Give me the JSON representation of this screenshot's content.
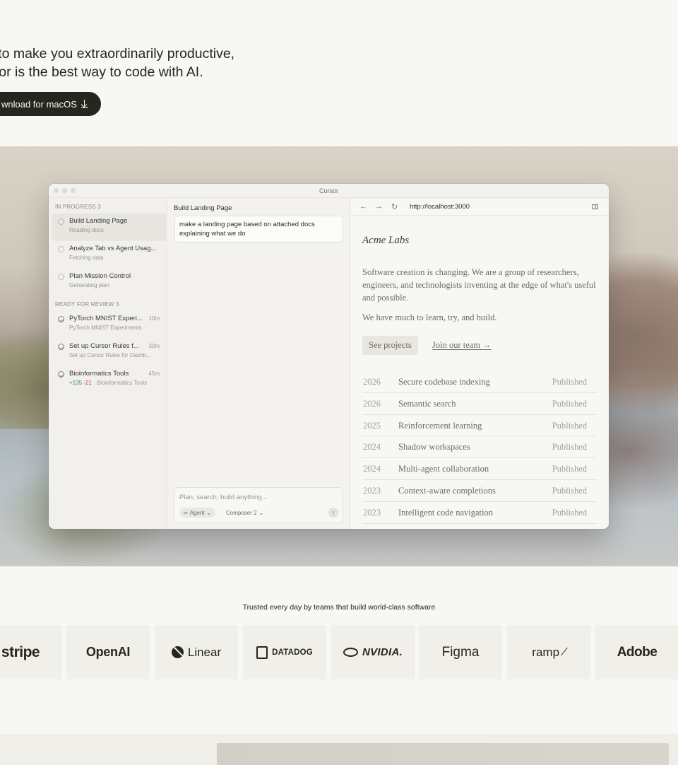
{
  "hero": {
    "headline_line1": "lt to make you extraordinarily productive,",
    "headline_line2": "rsor is the best way to code with AI.",
    "download_label": "wnload for macOS"
  },
  "window": {
    "title": "Cursor",
    "sidebar": {
      "in_progress_label": "IN PROGRESS 3",
      "in_progress": [
        {
          "name": "Build Landing Page",
          "sub": "Reading docs"
        },
        {
          "name": "Analyze Tab vs Agent Usag...",
          "sub": "Fetching data"
        },
        {
          "name": "Plan Mission Control",
          "sub": "Generating plan"
        }
      ],
      "review_label": "READY FOR REVIEW 3",
      "review": [
        {
          "name": "PyTorch MNIST Experi...",
          "time": "10m",
          "sub": "PyTorch MNIST Experiments"
        },
        {
          "name": "Set up Cursor Rules f...",
          "time": "30m",
          "sub": "Set up Cursor Rules for Dashb..."
        },
        {
          "name": "Bioinformatics Tools",
          "time": "45m",
          "add": "+135",
          "del": "-21",
          "sub": "· Bioinformatics Tools"
        }
      ]
    },
    "chat": {
      "title": "Build Landing Page",
      "message": "make a landing page based on attached docs explaining what we do",
      "composer_placeholder": "Plan, search, build anything...",
      "mode": "Agent",
      "model": "Composer 2"
    },
    "browser": {
      "url": "http://localhost:3000",
      "brand": "Acme Labs",
      "intro": "Software creation is changing. We are a group of researchers, engineers, and technologists inventing at the edge of what's useful and possible.",
      "intro2": "We have much to learn, try, and build.",
      "see_projects": "See projects",
      "join_team": "Join our team →",
      "projects": [
        {
          "year": "2026",
          "title": "Secure codebase indexing",
          "status": "Published"
        },
        {
          "year": "2026",
          "title": "Semantic search",
          "status": "Published"
        },
        {
          "year": "2025",
          "title": "Reinforcement learning",
          "status": "Published"
        },
        {
          "year": "2024",
          "title": "Shadow workspaces",
          "status": "Published"
        },
        {
          "year": "2024",
          "title": "Multi-agent collaboration",
          "status": "Published"
        },
        {
          "year": "2023",
          "title": "Context-aware completions",
          "status": "Published"
        },
        {
          "year": "2023",
          "title": "Intelligent code navigation",
          "status": "Published"
        }
      ]
    }
  },
  "logos": {
    "caption": "Trusted every day by teams that build world-class software",
    "names": [
      "stripe",
      "OpenAI",
      "Linear",
      "DATADOG",
      "NVIDIA.",
      "Figma",
      "ramp",
      "Adobe"
    ]
  },
  "colors": {
    "background": "#f7f7f4",
    "text": "#26251e",
    "button": "#26251e",
    "diff_add": "#3c8a4c",
    "diff_del": "#c0453a"
  }
}
